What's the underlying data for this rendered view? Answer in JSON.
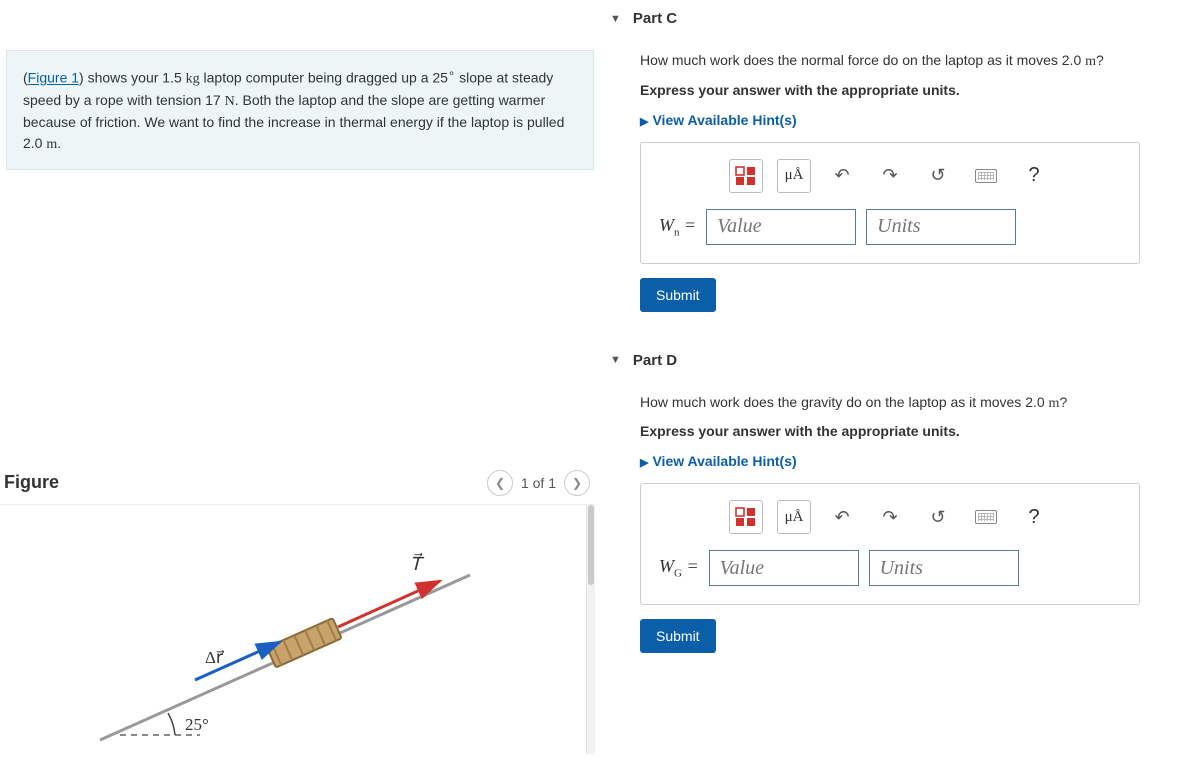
{
  "problem": {
    "figure_link": "Figure 1",
    "text_before": "(",
    "text_1": ") shows your 1.5 ",
    "u_kg": "kg",
    "text_2": " laptop computer being dragged up a 25",
    "deg": "∘",
    "text_3": " slope at steady speed by a rope with tension 17 ",
    "u_N": "N",
    "text_4": ". Both the laptop and the slope are getting warmer because of friction. We want to find the increase in thermal energy if the laptop is pulled 2.0 ",
    "u_m": "m",
    "text_5": "."
  },
  "figure": {
    "title": "Figure",
    "counter": "1 of 1",
    "angle_label": "25°",
    "dr_label": "Δr⃗",
    "T_label": "T⃗"
  },
  "partC": {
    "title": "Part C",
    "question_a": "How much work does the normal force do on the laptop as it moves 2.0 ",
    "u_m": "m",
    "question_b": "?",
    "instruction": "Express your answer with the appropriate units.",
    "hints_label": "View Available Hint(s)",
    "var_html": "W",
    "var_sub": "n",
    "value_ph": "Value",
    "units_ph": "Units",
    "mu_label": "μÅ",
    "submit": "Submit"
  },
  "partD": {
    "title": "Part D",
    "question_a": "How much work does the gravity do on the laptop as it moves 2.0 ",
    "u_m": "m",
    "question_b": "?",
    "instruction": "Express your answer with the appropriate units.",
    "hints_label": "View Available Hint(s)",
    "var_html": "W",
    "var_sub": "G",
    "value_ph": "Value",
    "units_ph": "Units",
    "mu_label": "μÅ",
    "submit": "Submit"
  }
}
